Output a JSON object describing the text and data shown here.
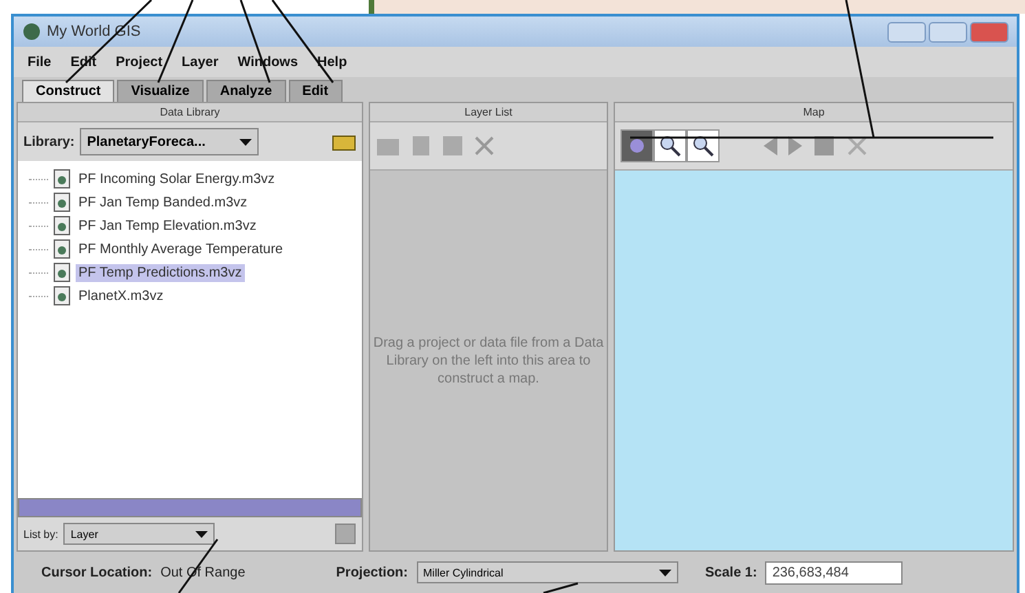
{
  "window": {
    "title": "My World GIS"
  },
  "menu": [
    "File",
    "Edit",
    "Project",
    "Layer",
    "Windows",
    "Help"
  ],
  "tabs": [
    {
      "label": "Construct",
      "selected": true
    },
    {
      "label": "Visualize",
      "selected": false
    },
    {
      "label": "Analyze",
      "selected": false
    },
    {
      "label": "Edit",
      "selected": false
    }
  ],
  "data_library": {
    "title": "Data Library",
    "library_label": "Library:",
    "library_value": "PlanetaryForeca...",
    "items": [
      {
        "label": "PF Incoming Solar Energy.m3vz",
        "selected": false
      },
      {
        "label": "PF Jan Temp Banded.m3vz",
        "selected": false
      },
      {
        "label": "PF Jan Temp Elevation.m3vz",
        "selected": false
      },
      {
        "label": "PF Monthly Average Temperature",
        "selected": false
      },
      {
        "label": "PF Temp Predictions.m3vz",
        "selected": true
      },
      {
        "label": "PlanetX.m3vz",
        "selected": false
      }
    ],
    "list_by_label": "List by:",
    "list_by_value": "Layer"
  },
  "layer_list": {
    "title": "Layer List",
    "hint": "Drag a project or data file from a Data Library on the left into this area to construct a map."
  },
  "map": {
    "title": "Map",
    "tools": [
      {
        "kind": "pan",
        "selected": true
      },
      {
        "kind": "zoom-in",
        "selected": false
      },
      {
        "kind": "zoom-out",
        "selected": false
      }
    ]
  },
  "status_bar": {
    "cursor_label": "Cursor Location:",
    "cursor_value": "Out Of Range",
    "projection_label": "Projection:",
    "projection_value": "Miller Cylindrical",
    "scale_label": "Scale 1:",
    "scale_value": "236,683,484"
  }
}
